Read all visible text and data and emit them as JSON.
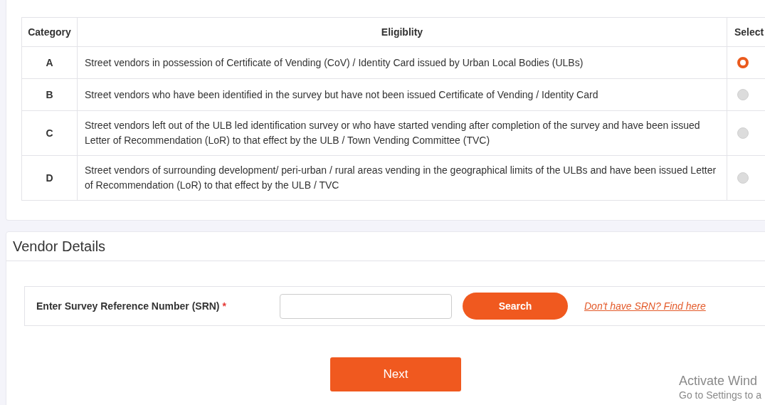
{
  "eligibility_table": {
    "columns": [
      "Category",
      "Eligiblity",
      "Select"
    ],
    "rows": [
      {
        "category": "A",
        "eligibility": "Street vendors in possession of Certificate of Vending (CoV) / Identity Card issued by Urban Local Bodies (ULBs)",
        "selected": true
      },
      {
        "category": "B",
        "eligibility": "Street vendors who have been identified in the survey but have not been issued Certificate of Vending / Identity Card",
        "selected": false
      },
      {
        "category": "C",
        "eligibility": "Street vendors left out of the ULB led identification survey or who have started vending after completion of the survey and have been issued Letter of Recommendation (LoR) to that effect by the ULB / Town Vending Committee (TVC)",
        "selected": false
      },
      {
        "category": "D",
        "eligibility": "Street vendors of surrounding development/ peri-urban / rural areas vending in the geographical limits of the ULBs and have been issued Letter of Recommendation (LoR) to that effect by the ULB / TVC",
        "selected": false
      }
    ]
  },
  "vendor_details": {
    "title": "Vendor Details",
    "srn_label": "Enter Survey Reference Number (SRN)",
    "required_mark": "*",
    "search_button": "Search",
    "help_link": "Don't have SRN? Find here",
    "next_button": "Next"
  },
  "os_overlay": {
    "title": "Activate Wind",
    "subtitle": "Go to Settings to a"
  }
}
